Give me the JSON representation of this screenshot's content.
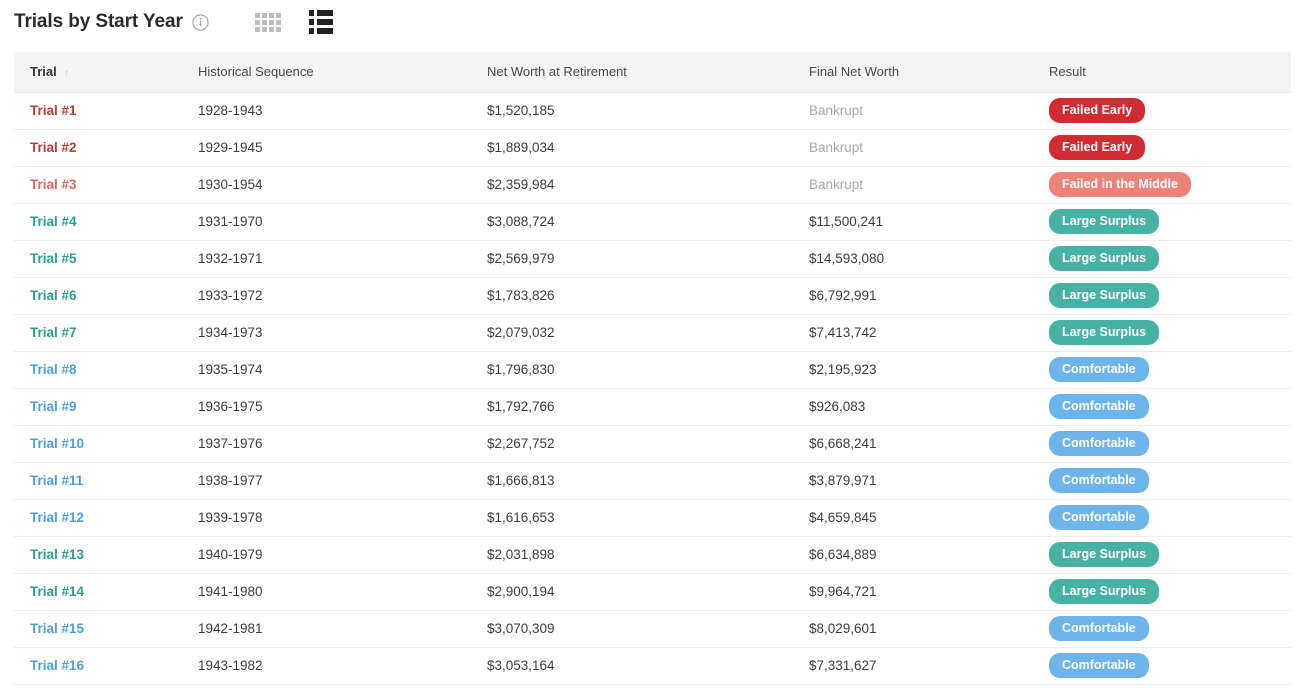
{
  "header": {
    "title": "Trials by Start Year",
    "info_icon": "info-circle-icon",
    "grid_view_icon": "grid-view-icon",
    "list_view_icon": "list-view-icon",
    "active_view": "list"
  },
  "table": {
    "columns": [
      {
        "label": "Trial",
        "sorted": true,
        "sort_direction": "asc",
        "sort_glyph": "↑"
      },
      {
        "label": "Historical Sequence",
        "sorted": false
      },
      {
        "label": "Net Worth at Retirement",
        "sorted": false
      },
      {
        "label": "Final Net Worth",
        "sorted": false
      },
      {
        "label": "Result",
        "sorted": false
      }
    ],
    "rows": [
      {
        "trial": "Trial #1",
        "sequence": "1928-1943",
        "net_worth_at_retirement": "$1,520,185",
        "final_net_worth": "Bankrupt",
        "final_is_bankrupt": true,
        "result": "Failed Early",
        "result_color": "#d32b32",
        "trial_color": "#c0392b"
      },
      {
        "trial": "Trial #2",
        "sequence": "1929-1945",
        "net_worth_at_retirement": "$1,889,034",
        "final_net_worth": "Bankrupt",
        "final_is_bankrupt": true,
        "result": "Failed Early",
        "result_color": "#d32b32",
        "trial_color": "#c0392b"
      },
      {
        "trial": "Trial #3",
        "sequence": "1930-1954",
        "net_worth_at_retirement": "$2,359,984",
        "final_net_worth": "Bankrupt",
        "final_is_bankrupt": true,
        "result": "Failed in the Middle",
        "result_color": "#ed8279",
        "trial_color": "#e2635b"
      },
      {
        "trial": "Trial #4",
        "sequence": "1931-1970",
        "net_worth_at_retirement": "$3,088,724",
        "final_net_worth": "$11,500,241",
        "final_is_bankrupt": false,
        "result": "Large Surplus",
        "result_color": "#46b2a4",
        "trial_color": "#27a08e"
      },
      {
        "trial": "Trial #5",
        "sequence": "1932-1971",
        "net_worth_at_retirement": "$2,569,979",
        "final_net_worth": "$14,593,080",
        "final_is_bankrupt": false,
        "result": "Large Surplus",
        "result_color": "#46b2a4",
        "trial_color": "#27a08e"
      },
      {
        "trial": "Trial #6",
        "sequence": "1933-1972",
        "net_worth_at_retirement": "$1,783,826",
        "final_net_worth": "$6,792,991",
        "final_is_bankrupt": false,
        "result": "Large Surplus",
        "result_color": "#46b2a4",
        "trial_color": "#27a08e"
      },
      {
        "trial": "Trial #7",
        "sequence": "1934-1973",
        "net_worth_at_retirement": "$2,079,032",
        "final_net_worth": "$7,413,742",
        "final_is_bankrupt": false,
        "result": "Large Surplus",
        "result_color": "#46b2a4",
        "trial_color": "#27a08e"
      },
      {
        "trial": "Trial #8",
        "sequence": "1935-1974",
        "net_worth_at_retirement": "$1,796,830",
        "final_net_worth": "$2,195,923",
        "final_is_bankrupt": false,
        "result": "Comfortable",
        "result_color": "#6cb4ea",
        "trial_color": "#4a9fe0"
      },
      {
        "trial": "Trial #9",
        "sequence": "1936-1975",
        "net_worth_at_retirement": "$1,792,766",
        "final_net_worth": "$926,083",
        "final_is_bankrupt": false,
        "result": "Comfortable",
        "result_color": "#6cb4ea",
        "trial_color": "#4a9fe0"
      },
      {
        "trial": "Trial #10",
        "sequence": "1937-1976",
        "net_worth_at_retirement": "$2,267,752",
        "final_net_worth": "$6,668,241",
        "final_is_bankrupt": false,
        "result": "Comfortable",
        "result_color": "#6cb4ea",
        "trial_color": "#4a9fe0"
      },
      {
        "trial": "Trial #11",
        "sequence": "1938-1977",
        "net_worth_at_retirement": "$1,666,813",
        "final_net_worth": "$3,879,971",
        "final_is_bankrupt": false,
        "result": "Comfortable",
        "result_color": "#6cb4ea",
        "trial_color": "#4a9fe0"
      },
      {
        "trial": "Trial #12",
        "sequence": "1939-1978",
        "net_worth_at_retirement": "$1,616,653",
        "final_net_worth": "$4,659,845",
        "final_is_bankrupt": false,
        "result": "Comfortable",
        "result_color": "#6cb4ea",
        "trial_color": "#4a9fe0"
      },
      {
        "trial": "Trial #13",
        "sequence": "1940-1979",
        "net_worth_at_retirement": "$2,031,898",
        "final_net_worth": "$6,634,889",
        "final_is_bankrupt": false,
        "result": "Large Surplus",
        "result_color": "#46b2a4",
        "trial_color": "#27a08e"
      },
      {
        "trial": "Trial #14",
        "sequence": "1941-1980",
        "net_worth_at_retirement": "$2,900,194",
        "final_net_worth": "$9,964,721",
        "final_is_bankrupt": false,
        "result": "Large Surplus",
        "result_color": "#46b2a4",
        "trial_color": "#27a08e"
      },
      {
        "trial": "Trial #15",
        "sequence": "1942-1981",
        "net_worth_at_retirement": "$3,070,309",
        "final_net_worth": "$8,029,601",
        "final_is_bankrupt": false,
        "result": "Comfortable",
        "result_color": "#6cb4ea",
        "trial_color": "#4a9fe0"
      },
      {
        "trial": "Trial #16",
        "sequence": "1943-1982",
        "net_worth_at_retirement": "$3,053,164",
        "final_net_worth": "$7,331,627",
        "final_is_bankrupt": false,
        "result": "Comfortable",
        "result_color": "#6cb4ea",
        "trial_color": "#4a9fe0"
      }
    ]
  }
}
